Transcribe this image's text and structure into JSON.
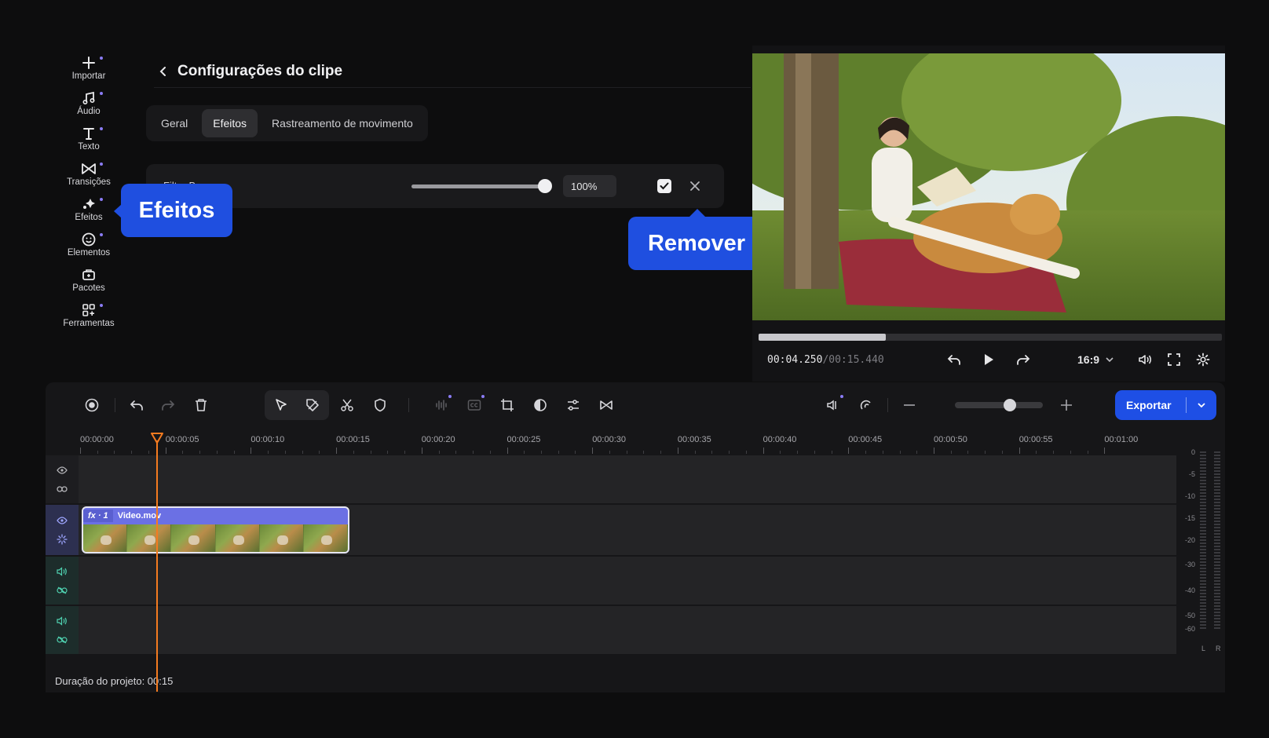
{
  "sidebar": {
    "items": [
      {
        "label": "Importar",
        "icon": "plus-icon"
      },
      {
        "label": "Áudio",
        "icon": "music-note-icon"
      },
      {
        "label": "Texto",
        "icon": "text-icon"
      },
      {
        "label": "Transições",
        "icon": "bowtie-transition-icon"
      },
      {
        "label": "Efeitos",
        "icon": "sparkle-icon"
      },
      {
        "label": "Elementos",
        "icon": "smiley-icon"
      },
      {
        "label": "Pacotes",
        "icon": "briefcase-plus-icon"
      },
      {
        "label": "Ferramentas",
        "icon": "grid-plus-icon"
      }
    ]
  },
  "panel": {
    "title": "Configurações do clipe",
    "tabs": [
      {
        "label": "Geral",
        "active": false
      },
      {
        "label": "Efeitos",
        "active": true
      },
      {
        "label": "Rastreamento de movimento",
        "active": false
      }
    ],
    "effect": {
      "name": "Filtro Bruma",
      "intensity_percent": 100,
      "intensity_label": "100%",
      "enabled": true
    }
  },
  "callouts": {
    "effects": "Efeitos",
    "remove": "Remover"
  },
  "preview": {
    "current_time": "00:04.250",
    "total_time": "/00:15.440",
    "progress_fraction": 0.275,
    "aspect_ratio": "16:9"
  },
  "timeline": {
    "export_label": "Exportar",
    "zoom_fraction": 0.6,
    "ruler_labels": [
      "00:00:00",
      "00:00:05",
      "00:00:10",
      "00:00:15",
      "00:00:20",
      "00:00:25",
      "00:00:30",
      "00:00:35",
      "00:00:40",
      "00:00:45",
      "00:00:50",
      "00:00:55",
      "00:01:00"
    ],
    "clip": {
      "fx_label": "fx · 1",
      "name": "Video.mov"
    },
    "meter_labels": [
      "0",
      "-5",
      "-10",
      "-15",
      "-20",
      "-30",
      "-40",
      "-50",
      "-60"
    ],
    "meter_channels": [
      "L",
      "R"
    ],
    "status": "Duração do projeto: 00:15"
  },
  "colors": {
    "accent": "#1f4fe0",
    "playhead": "#f47b20",
    "clip": "#6b70e4",
    "indicator_dot": "#8b7cf6"
  }
}
